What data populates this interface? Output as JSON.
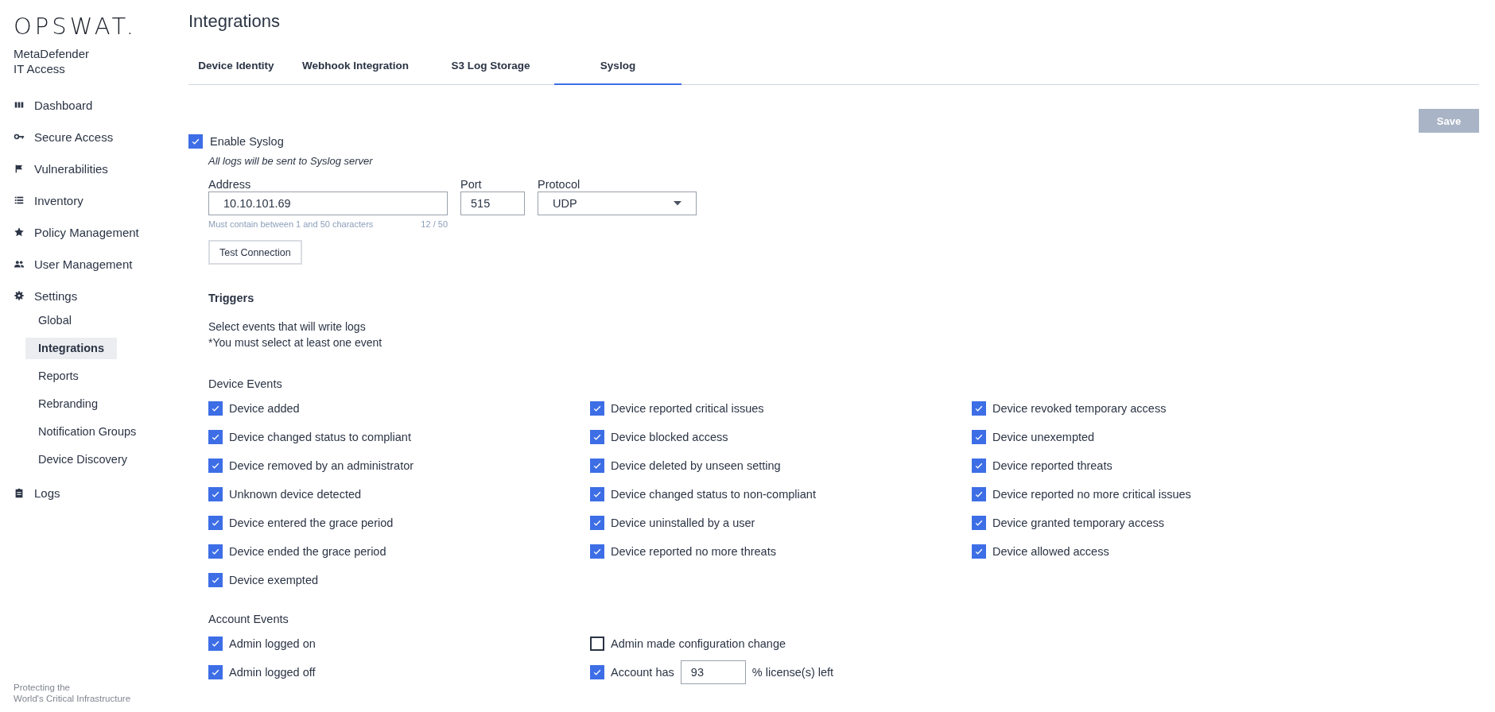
{
  "sidebar": {
    "logo": "OPSWAT.",
    "product": [
      "MetaDefender",
      "IT Access"
    ],
    "items": [
      {
        "label": "Dashboard"
      },
      {
        "label": "Secure Access"
      },
      {
        "label": "Vulnerabilities"
      },
      {
        "label": "Inventory"
      },
      {
        "label": "Policy Management"
      },
      {
        "label": "User Management"
      },
      {
        "label": "Settings",
        "children": [
          {
            "label": "Global",
            "selected": false
          },
          {
            "label": "Integrations",
            "selected": true
          },
          {
            "label": "Reports",
            "selected": false
          },
          {
            "label": "Rebranding",
            "selected": false
          },
          {
            "label": "Notification Groups",
            "selected": false
          },
          {
            "label": "Device Discovery",
            "selected": false
          }
        ]
      },
      {
        "label": "Logs"
      }
    ],
    "footer": [
      "Protecting the",
      "World's Critical Infrastructure"
    ]
  },
  "page": {
    "title": "Integrations"
  },
  "tabs": [
    {
      "label": "Device Identity",
      "selected": false
    },
    {
      "label": "Webhook Integration",
      "selected": false
    },
    {
      "label": "S3 Log Storage",
      "selected": false
    },
    {
      "label": "Syslog",
      "selected": true
    }
  ],
  "save_button": {
    "label": "Save",
    "disabled": true
  },
  "enable": {
    "label": "Enable Syslog",
    "checked": true,
    "note": "All logs will be sent to Syslog server"
  },
  "address": {
    "label": "Address",
    "value": "10.10.101.69",
    "hint": "Must contain between 1 and 50 characters",
    "counter": "12 / 50"
  },
  "port": {
    "label": "Port",
    "value": "515"
  },
  "protocol": {
    "label": "Protocol",
    "value": "UDP"
  },
  "test_button": {
    "label": "Test Connection"
  },
  "triggers": {
    "title": "Triggers",
    "lines": [
      "Select events that will write logs",
      "*You must select at least one event"
    ]
  },
  "device_events": {
    "title": "Device Events",
    "items": [
      {
        "label": "Device added",
        "checked": true
      },
      {
        "label": "Device reported critical issues",
        "checked": true
      },
      {
        "label": "Device revoked temporary access",
        "checked": true
      },
      {
        "label": "Device changed status to compliant",
        "checked": true
      },
      {
        "label": "Device blocked access",
        "checked": true
      },
      {
        "label": "Device unexempted",
        "checked": true
      },
      {
        "label": "Device removed by an administrator",
        "checked": true
      },
      {
        "label": "Device deleted by unseen setting",
        "checked": true
      },
      {
        "label": "Device reported threats",
        "checked": true
      },
      {
        "label": "Unknown device detected",
        "checked": true
      },
      {
        "label": "Device changed status to non-compliant",
        "checked": true
      },
      {
        "label": "Device reported no more critical issues",
        "checked": true
      },
      {
        "label": "Device entered the grace period",
        "checked": true
      },
      {
        "label": "Device uninstalled by a user",
        "checked": true
      },
      {
        "label": "Device granted temporary access",
        "checked": true
      },
      {
        "label": "Device ended the grace period",
        "checked": true
      },
      {
        "label": "Device reported no more threats",
        "checked": true
      },
      {
        "label": "Device allowed access",
        "checked": true
      },
      {
        "label": "Device exempted",
        "checked": true
      }
    ]
  },
  "account_events": {
    "title": "Account Events",
    "items": [
      {
        "kind": "plain",
        "label": "Admin logged on",
        "checked": true
      },
      {
        "kind": "plain",
        "label": "Admin made configuration change",
        "checked": false
      },
      {
        "kind": "plain",
        "label": "Admin logged off",
        "checked": true
      },
      {
        "kind": "threshold",
        "label": "Account has",
        "value": "93",
        "suffix": "% license(s) left",
        "checked": true
      }
    ]
  }
}
